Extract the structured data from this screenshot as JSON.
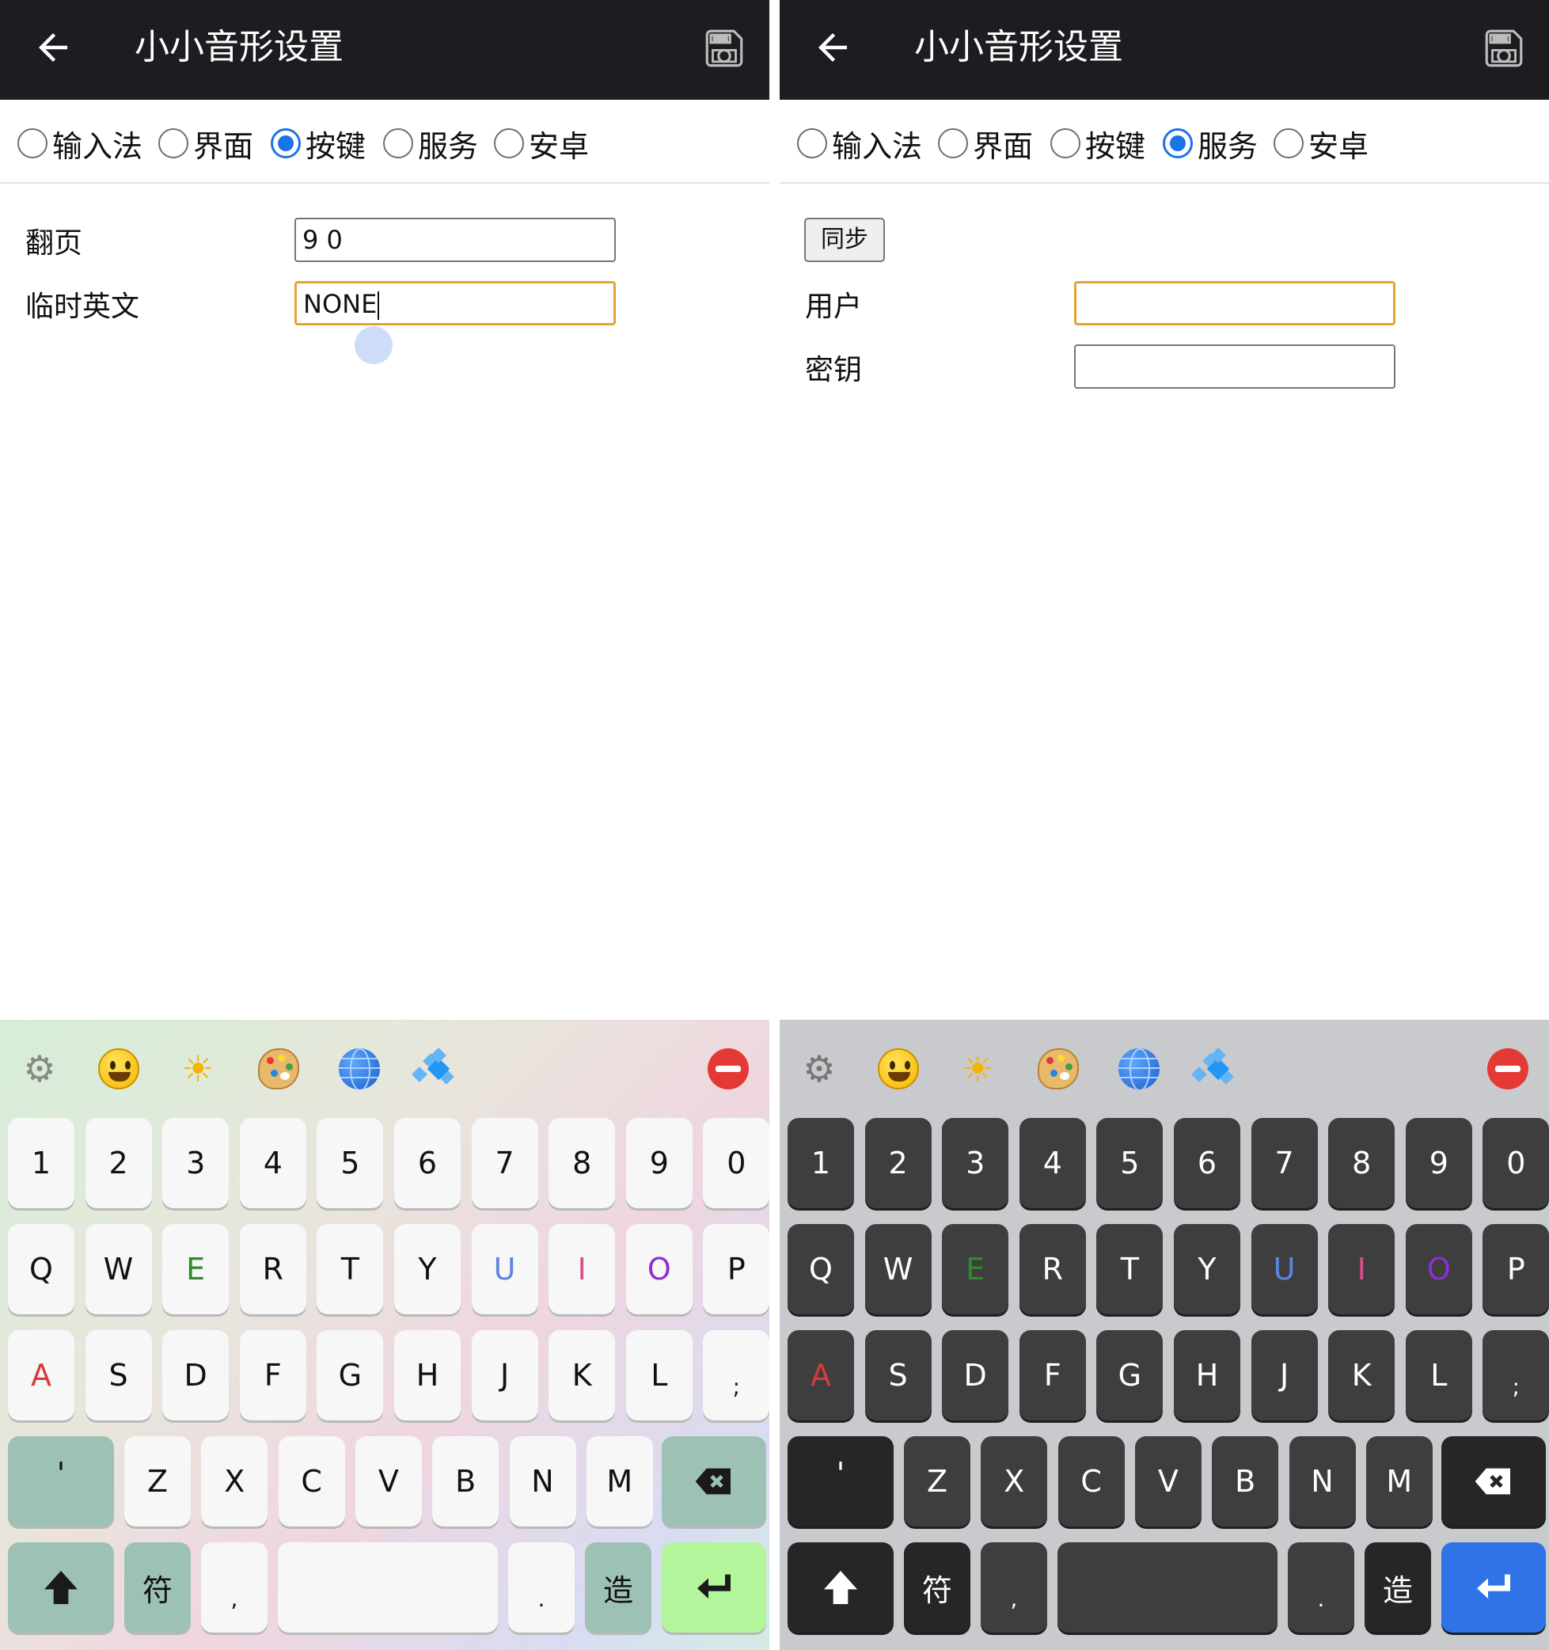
{
  "colors": {
    "appbar": "#1c1c21",
    "radio_checked": "#1a73e8",
    "focus_border": "#e4a336",
    "key_color_E": "#2e8b2e",
    "key_color_U": "#5b86e5",
    "key_color_I": "#d94f8a",
    "key_color_O": "#8e2ed6",
    "key_color_A": "#d83a3a"
  },
  "panels": [
    {
      "appbar": {
        "title": "小小音形设置",
        "back_icon": "arrow-left-icon",
        "save_icon": "floppy-disk-icon"
      },
      "tabs": [
        {
          "label": "输入法",
          "checked": false
        },
        {
          "label": "界面",
          "checked": false
        },
        {
          "label": "按键",
          "checked": true
        },
        {
          "label": "服务",
          "checked": false
        },
        {
          "label": "安卓",
          "checked": false
        }
      ],
      "form": {
        "page_label": "翻页",
        "page_value": "9 0",
        "temp_english_label": "临时英文",
        "temp_english_value": "NONE"
      },
      "keyboard_theme": "light"
    },
    {
      "appbar": {
        "title": "小小音形设置",
        "back_icon": "arrow-left-icon",
        "save_icon": "floppy-disk-icon"
      },
      "tabs": [
        {
          "label": "输入法",
          "checked": false
        },
        {
          "label": "界面",
          "checked": false
        },
        {
          "label": "按键",
          "checked": false
        },
        {
          "label": "服务",
          "checked": true
        },
        {
          "label": "安卓",
          "checked": false
        }
      ],
      "form": {
        "sync_button": "同步",
        "user_label": "用户",
        "user_value": "",
        "key_label": "密钥",
        "key_value": ""
      },
      "keyboard_theme": "dark"
    }
  ],
  "keyboard": {
    "toolbar_icons": [
      "gear-icon",
      "smiley-icon",
      "sun-icon",
      "palette-icon",
      "globe-icon",
      "diamond-icon",
      "stop-icon"
    ],
    "row1": [
      "1",
      "2",
      "3",
      "4",
      "5",
      "6",
      "7",
      "8",
      "9",
      "0"
    ],
    "row2": [
      "Q",
      "W",
      "E",
      "R",
      "T",
      "Y",
      "U",
      "I",
      "O",
      "P"
    ],
    "row3": [
      "A",
      "S",
      "D",
      "F",
      "G",
      "H",
      "J",
      "K",
      "L",
      ";"
    ],
    "row4": [
      "'",
      "Z",
      "X",
      "C",
      "V",
      "B",
      "N",
      "M"
    ],
    "row5": {
      "symbol": "符",
      "comma": ",",
      "period": ".",
      "create": "造"
    },
    "special_icons": {
      "shift": "shift-arrow-icon",
      "backspace": "backspace-icon",
      "enter": "enter-arrow-icon"
    }
  }
}
